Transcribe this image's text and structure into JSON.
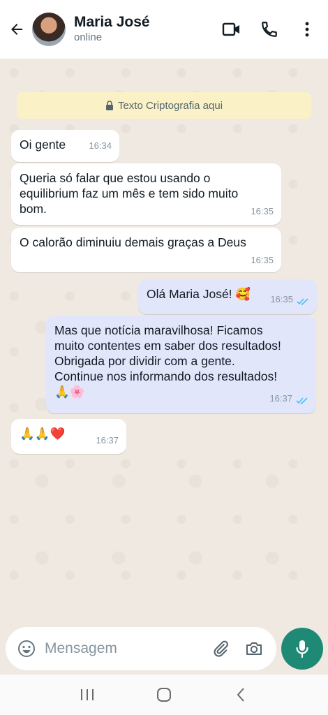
{
  "header": {
    "contact_name": "Maria José",
    "status": "online"
  },
  "chat": {
    "encryption_banner": "Texto Criptografia aqui",
    "messages": [
      {
        "direction": "in",
        "text": "Oi gente",
        "time": "16:34"
      },
      {
        "direction": "in",
        "text": "Queria só falar que estou usando o\nequilibrium faz um mês e tem sido muito\nbom.",
        "time": "16:35"
      },
      {
        "direction": "in",
        "text": "O calorão diminuiu demais graças a Deus",
        "time": "16:35"
      },
      {
        "direction": "out",
        "text": "Olá Maria José! 🥰",
        "time": "16:35",
        "status": "read"
      },
      {
        "direction": "out",
        "text": "Mas que notícia maravilhosa! Ficamos\nmuito contentes em saber dos resultados!\nObrigada por dividir com a gente.\nContinue nos informando dos resultados!\n🙏🌸",
        "time": "16:37",
        "status": "read"
      },
      {
        "direction": "in",
        "text": "🙏🙏❤️",
        "time": "16:37"
      }
    ]
  },
  "input": {
    "placeholder": "Mensagem",
    "value": ""
  },
  "colors": {
    "accent": "#1e8a75",
    "outgoing_bubble": "#e2e6fb",
    "incoming_bubble": "#ffffff",
    "read_ticks": "#53bdeb",
    "banner": "#fbf1c7"
  },
  "icons": {
    "back": "arrow-left-icon",
    "video": "video-camera-icon",
    "call": "phone-icon",
    "menu": "more-vertical-icon",
    "lock": "lock-icon",
    "emoji": "emoji-icon",
    "attach": "paperclip-icon",
    "camera": "camera-icon",
    "mic": "microphone-icon"
  }
}
